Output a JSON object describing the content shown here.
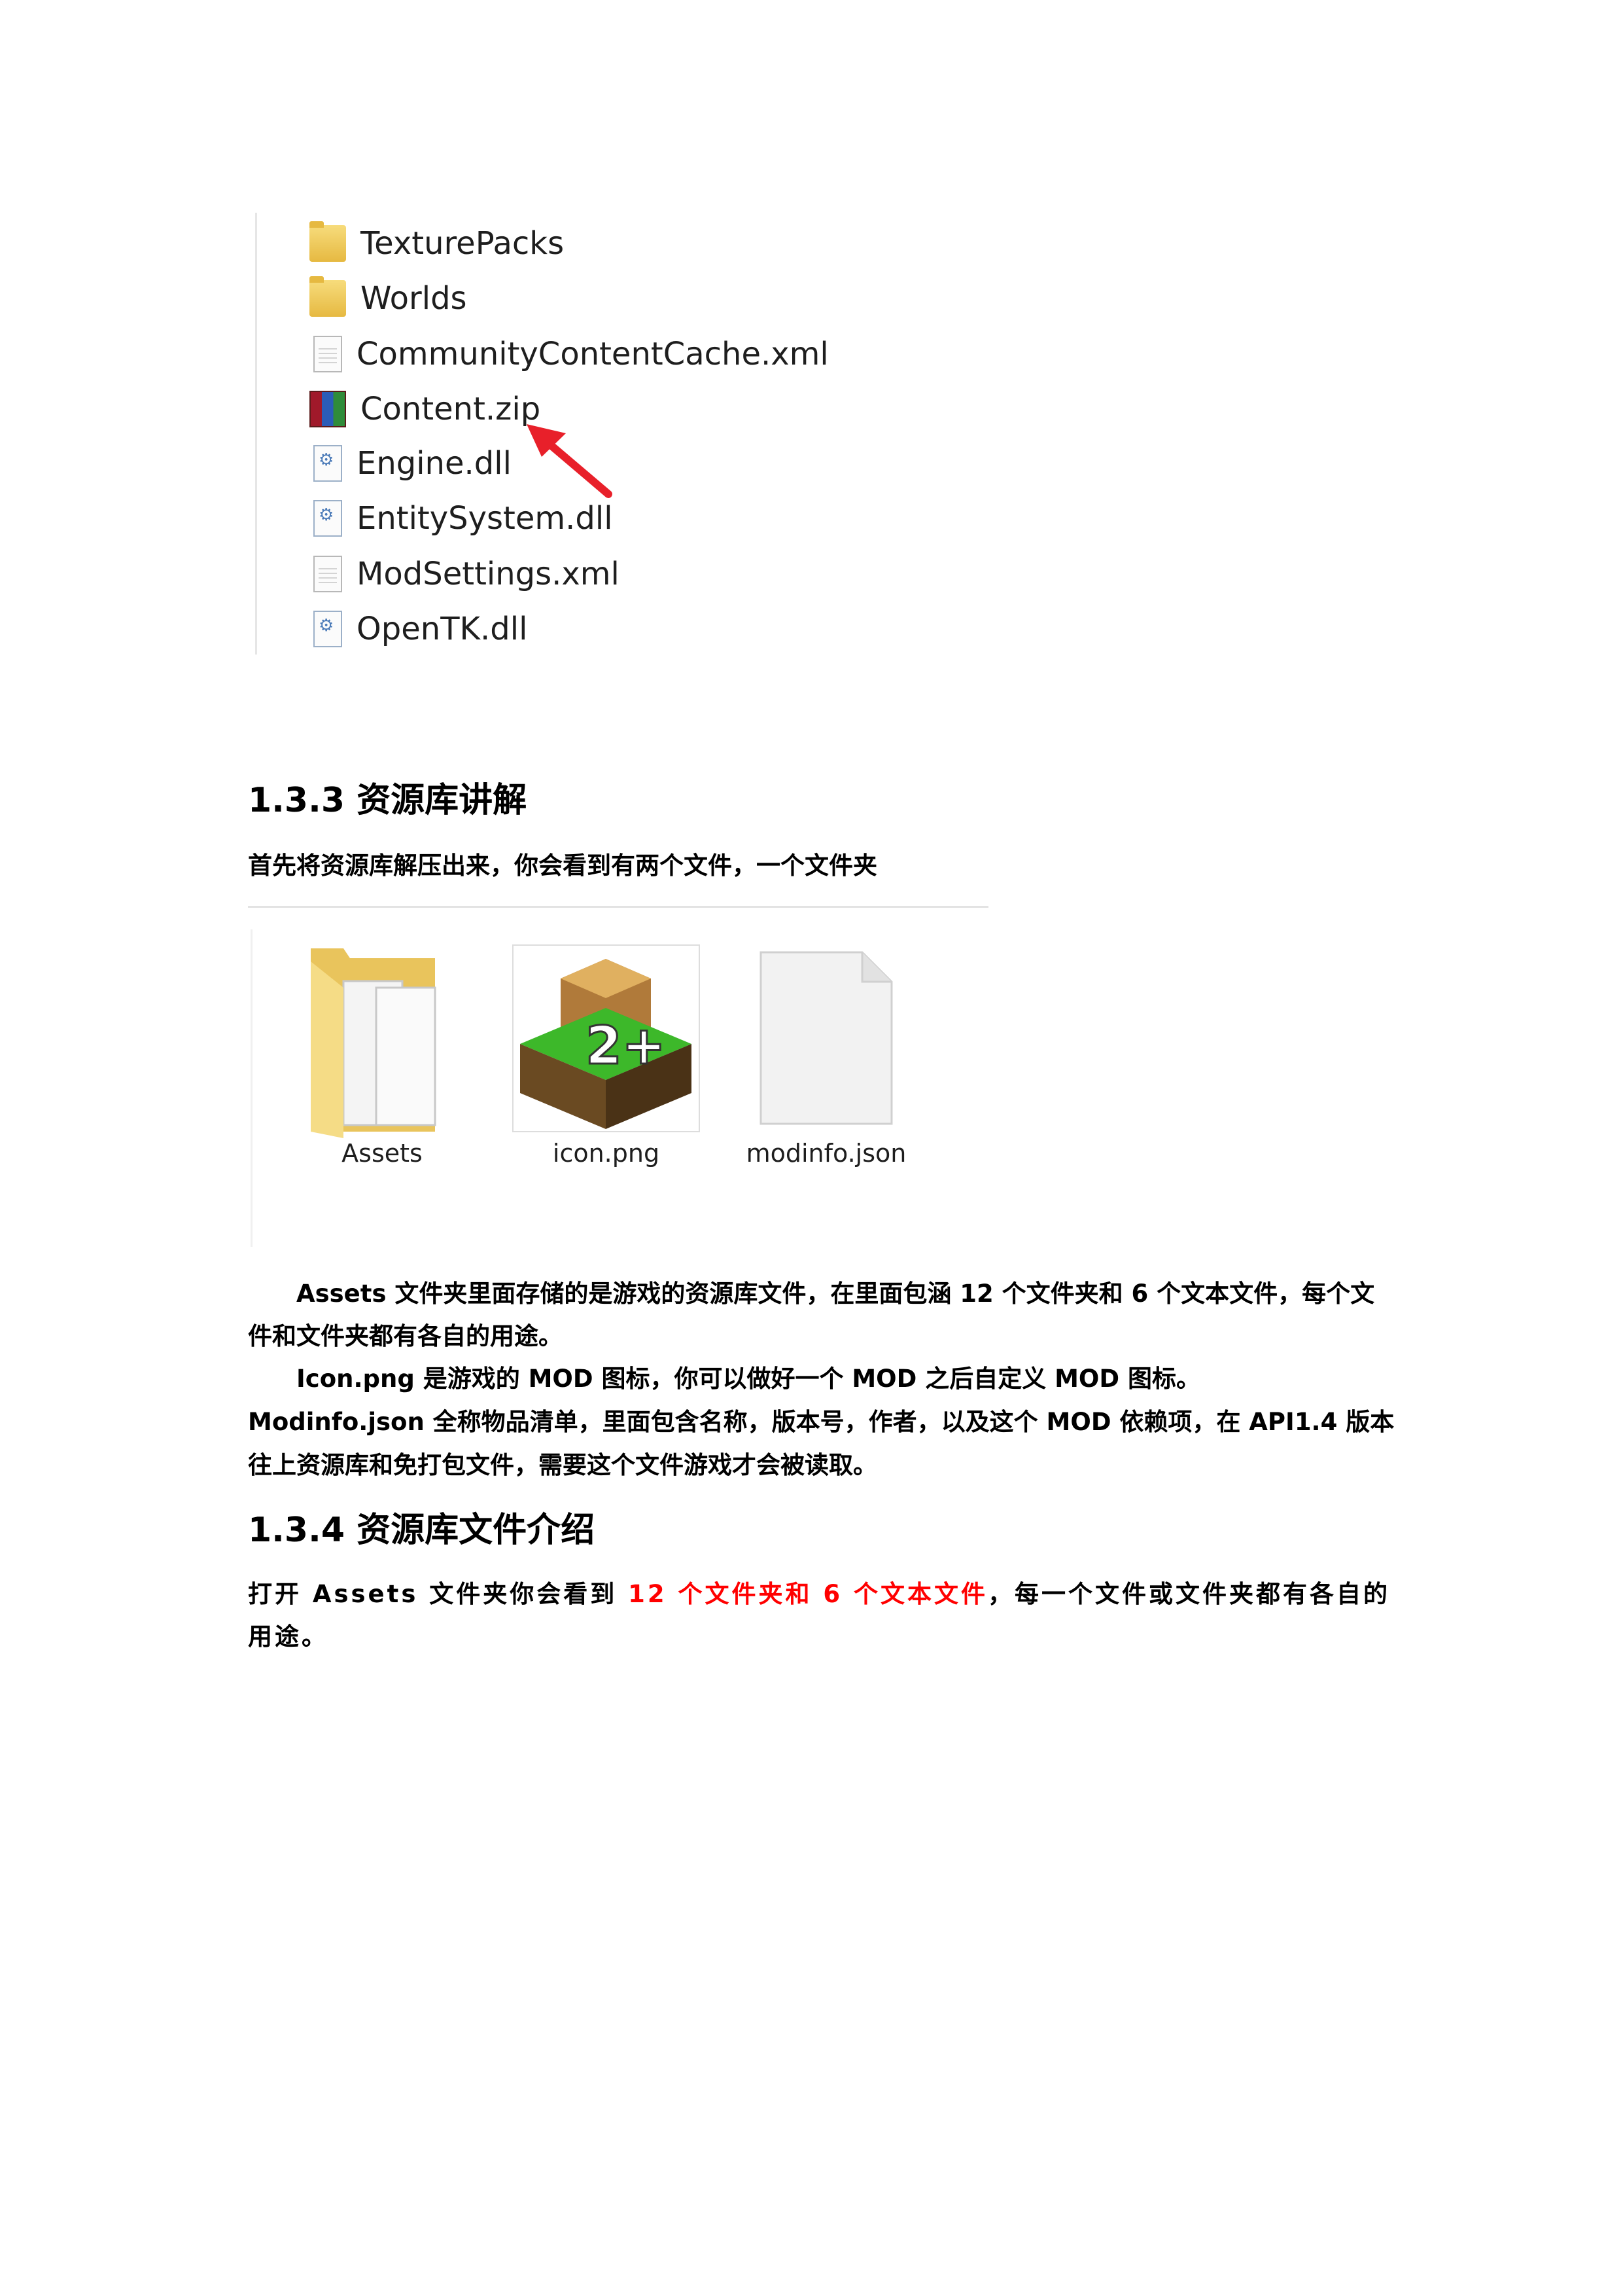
{
  "file_list": {
    "items": [
      {
        "name": "TexturePacks",
        "icon": "folder-icon"
      },
      {
        "name": "Worlds",
        "icon": "folder-icon"
      },
      {
        "name": "CommunityContentCache.xml",
        "icon": "xml-document-icon"
      },
      {
        "name": "Content.zip",
        "icon": "winrar-archive-icon"
      },
      {
        "name": "Engine.dll",
        "icon": "dll-file-icon"
      },
      {
        "name": "EntitySystem.dll",
        "icon": "dll-file-icon"
      },
      {
        "name": "ModSettings.xml",
        "icon": "xml-document-icon"
      },
      {
        "name": "OpenTK.dll",
        "icon": "dll-file-icon"
      }
    ],
    "annotation_color": "#e8202a"
  },
  "section_133": {
    "heading": "1.3.3 资源库讲解",
    "intro": "首先将资源库解压出来，你会看到有两个文件，一个文件夹"
  },
  "thumbnails": [
    {
      "name": "Assets",
      "icon": "folder-icon"
    },
    {
      "name": "icon.png",
      "icon": "survivalcraft-icon"
    },
    {
      "name": "modinfo.json",
      "icon": "blank-file-icon"
    }
  ],
  "paragraphs": {
    "assets_l1": "Assets 文件夹里面存储的是游戏的资源库文件，在里面包涵 12 个文件夹和 6 个文本文件，每个文",
    "assets_l2": "件和文件夹都有各自的用途。",
    "icon_l1": "Icon.png 是游戏的 MOD 图标，你可以做好一个 MOD 之后自定义 MOD 图标。",
    "modinfo_l1": "Modinfo.json 全称物品清单，里面包含名称，版本号，作者，以及这个 MOD 依赖项，在 API1.4 版本",
    "modinfo_l2": "往上资源库和免打包文件，需要这个文件游戏才会被读取。"
  },
  "section_134": {
    "heading": "1.3.4 资源库文件介绍",
    "text_a": "打开 Assets 文件夹你会看到 ",
    "text_red": "12 个文件夹和 6 个文本文件",
    "text_b": "，每一个文件或文件夹都有各自的",
    "text_c": "用途。",
    "highlight_color": "#ff0000"
  }
}
